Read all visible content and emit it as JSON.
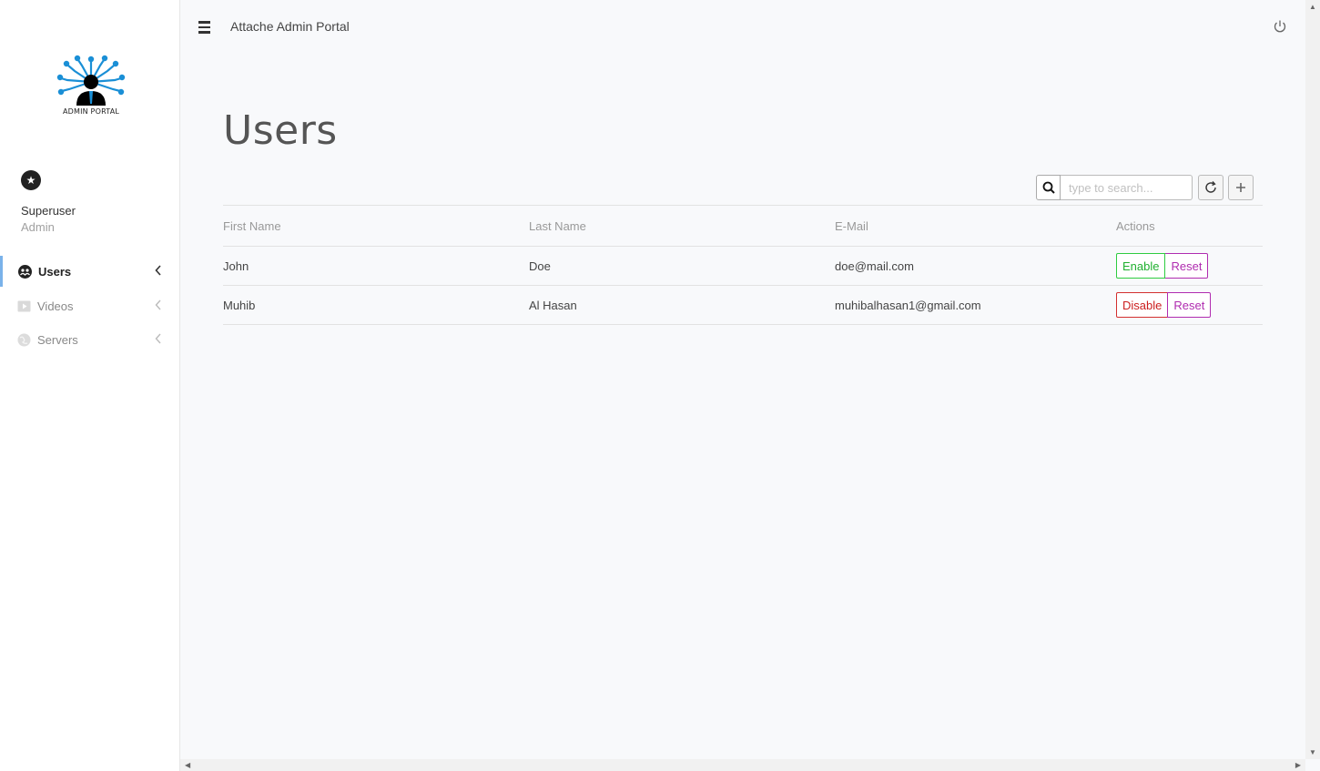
{
  "app": {
    "title": "Attache Admin Portal",
    "logo_text": "ADMIN PORTAL"
  },
  "user": {
    "name": "Superuser",
    "role": "Admin",
    "avatar_icon": "star-icon"
  },
  "sidebar": {
    "items": [
      {
        "label": "Users",
        "icon": "users-icon",
        "active": true
      },
      {
        "label": "Videos",
        "icon": "video-icon",
        "active": false
      },
      {
        "label": "Servers",
        "icon": "globe-icon",
        "active": false
      }
    ]
  },
  "page": {
    "title": "Users"
  },
  "toolbar": {
    "search_placeholder": "type to search..."
  },
  "table": {
    "headers": [
      "First Name",
      "Last Name",
      "E-Mail",
      "Actions"
    ],
    "rows": [
      {
        "first_name": "John",
        "last_name": "Doe",
        "email": "doe@mail.com",
        "toggle_label": "Enable",
        "reset_label": "Reset"
      },
      {
        "first_name": "Muhib",
        "last_name": "Al Hasan",
        "email": "muhibalhasan1@gmail.com",
        "toggle_label": "Disable",
        "reset_label": "Reset"
      }
    ]
  },
  "colors": {
    "accent": "#7ab2ea",
    "enable": "#2ecc40",
    "disable": "#d32f2f",
    "reset": "#b02cb0",
    "logo": "#1a8fd6"
  }
}
